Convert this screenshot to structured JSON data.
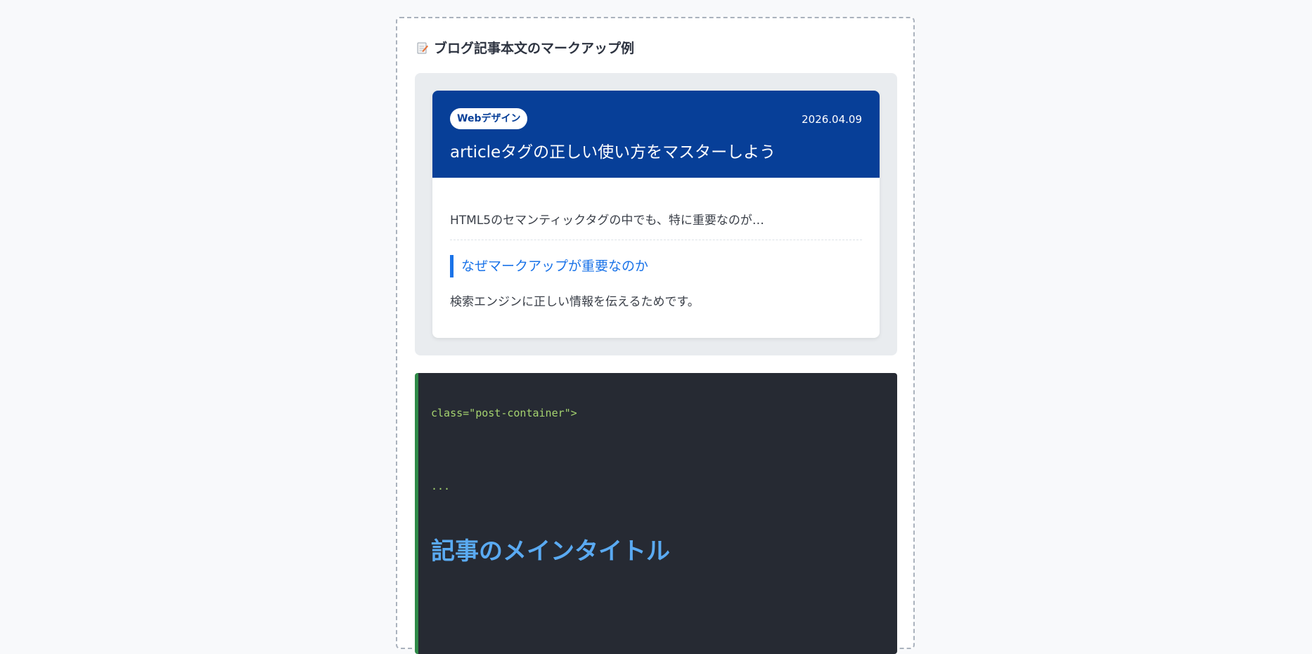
{
  "section": {
    "title": "ブログ記事本文のマークアップ例",
    "icon": "memo-icon"
  },
  "post": {
    "category": "Webデザイン",
    "date": "2026.04.09",
    "title": "articleタグの正しい使い方をマスターしよう",
    "excerpt": "HTML5のセマンティックタグの中でも、特に重要なのが…",
    "subheading": "なぜマークアップが重要なのか",
    "body": "検索エンジンに正しい情報を伝えるためです。"
  },
  "code": {
    "line1": "class=\"post-container\">",
    "line2": "...",
    "heading": "記事のメインタイトル"
  },
  "colors": {
    "header_bg": "#073f98",
    "accent_blue": "#1a73e8",
    "code_bg": "#262a33",
    "code_border": "#2f8a48",
    "code_text": "#a5d36f",
    "code_heading": "#5aaaf2"
  }
}
